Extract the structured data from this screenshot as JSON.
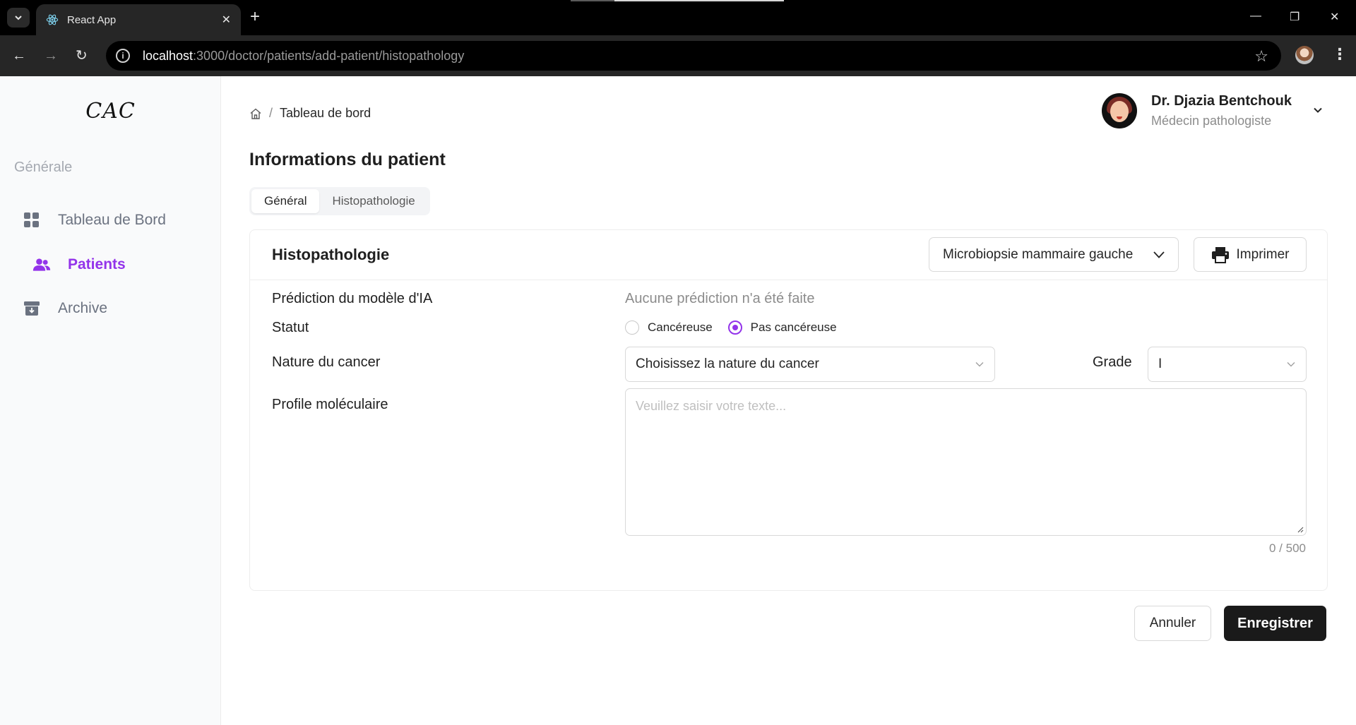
{
  "browser": {
    "tab_title": "React App",
    "url_host": "localhost",
    "url_path": ":3000/doctor/patients/add-patient/histopathology"
  },
  "sidebar": {
    "logo": "CAC",
    "section": "Générale",
    "items": [
      {
        "label": "Tableau de Bord",
        "icon": "dashboard-grid-icon",
        "active": false
      },
      {
        "label": "Patients",
        "icon": "users-icon",
        "active": true
      },
      {
        "label": "Archive",
        "icon": "archive-box-icon",
        "active": false
      }
    ]
  },
  "header": {
    "breadcrumb": [
      "Tableau de bord"
    ],
    "user": {
      "name": "Dr. Djazia Bentchouk",
      "role": "Médecin pathologiste"
    }
  },
  "page": {
    "title": "Informations du patient",
    "tabs": [
      {
        "label": "Général",
        "active": true
      },
      {
        "label": "Histopathologie",
        "active": false
      }
    ]
  },
  "card": {
    "title": "Histopathologie",
    "biopsy_select": "Microbiopsie mammaire gauche",
    "print_label": "Imprimer",
    "fields": {
      "prediction_label": "Prédiction du modèle d'IA",
      "prediction_value": "Aucune prédiction n'a été faite",
      "status_label": "Statut",
      "status_options": [
        "Cancéreuse",
        "Pas cancéreuse"
      ],
      "status_selected": "Pas cancéreuse",
      "nature_label": "Nature du cancer",
      "nature_placeholder": "Choisissez la nature du cancer",
      "grade_label": "Grade",
      "grade_value": "I",
      "molecular_label": "Profile moléculaire",
      "molecular_placeholder": "Veuillez saisir votre texte...",
      "counter": "0 / 500"
    }
  },
  "actions": {
    "cancel": "Annuler",
    "save": "Enregistrer"
  },
  "colors": {
    "accent": "#9333ea",
    "primary_button": "#1a1a1a"
  }
}
